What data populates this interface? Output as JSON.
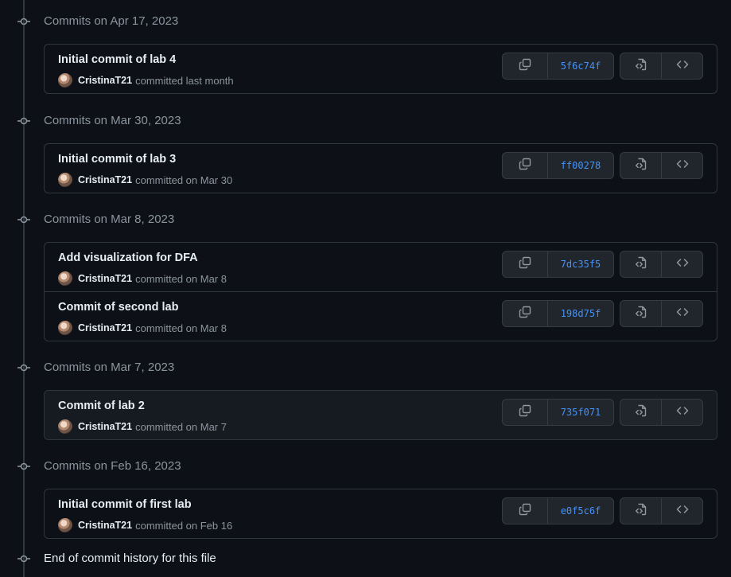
{
  "groups": [
    {
      "title": "Commits on Apr 17, 2023",
      "commits": [
        {
          "message": "Initial commit of lab 4",
          "author": "CristinaT21",
          "when": "committed last month",
          "sha": "5f6c74f"
        }
      ]
    },
    {
      "title": "Commits on Mar 30, 2023",
      "commits": [
        {
          "message": "Initial commit of lab 3",
          "author": "CristinaT21",
          "when": "committed on Mar 30",
          "sha": "ff00278"
        }
      ]
    },
    {
      "title": "Commits on Mar 8, 2023",
      "commits": [
        {
          "message": "Add visualization for DFA",
          "author": "CristinaT21",
          "when": "committed on Mar 8",
          "sha": "7dc35f5"
        },
        {
          "message": "Commit of second lab",
          "author": "CristinaT21",
          "when": "committed on Mar 8",
          "sha": "198d75f"
        }
      ]
    },
    {
      "title": "Commits on Mar 7, 2023",
      "commits": [
        {
          "message": "Commit of lab 2",
          "author": "CristinaT21",
          "when": "committed on Mar 7",
          "sha": "735f071"
        }
      ]
    },
    {
      "title": "Commits on Feb 16, 2023",
      "commits": [
        {
          "message": "Initial commit of first lab",
          "author": "CristinaT21",
          "when": "committed on Feb 16",
          "sha": "e0f5c6f"
        }
      ]
    }
  ],
  "end_text": "End of commit history for this file",
  "icons": {
    "node": "git-commit-icon",
    "copy": "copy-icon",
    "browse": "file-code-icon",
    "code": "code-icon"
  },
  "colors": {
    "background": "#0d1117",
    "border": "#30363d",
    "sha_link": "#4493f8",
    "muted": "#8b949e"
  }
}
